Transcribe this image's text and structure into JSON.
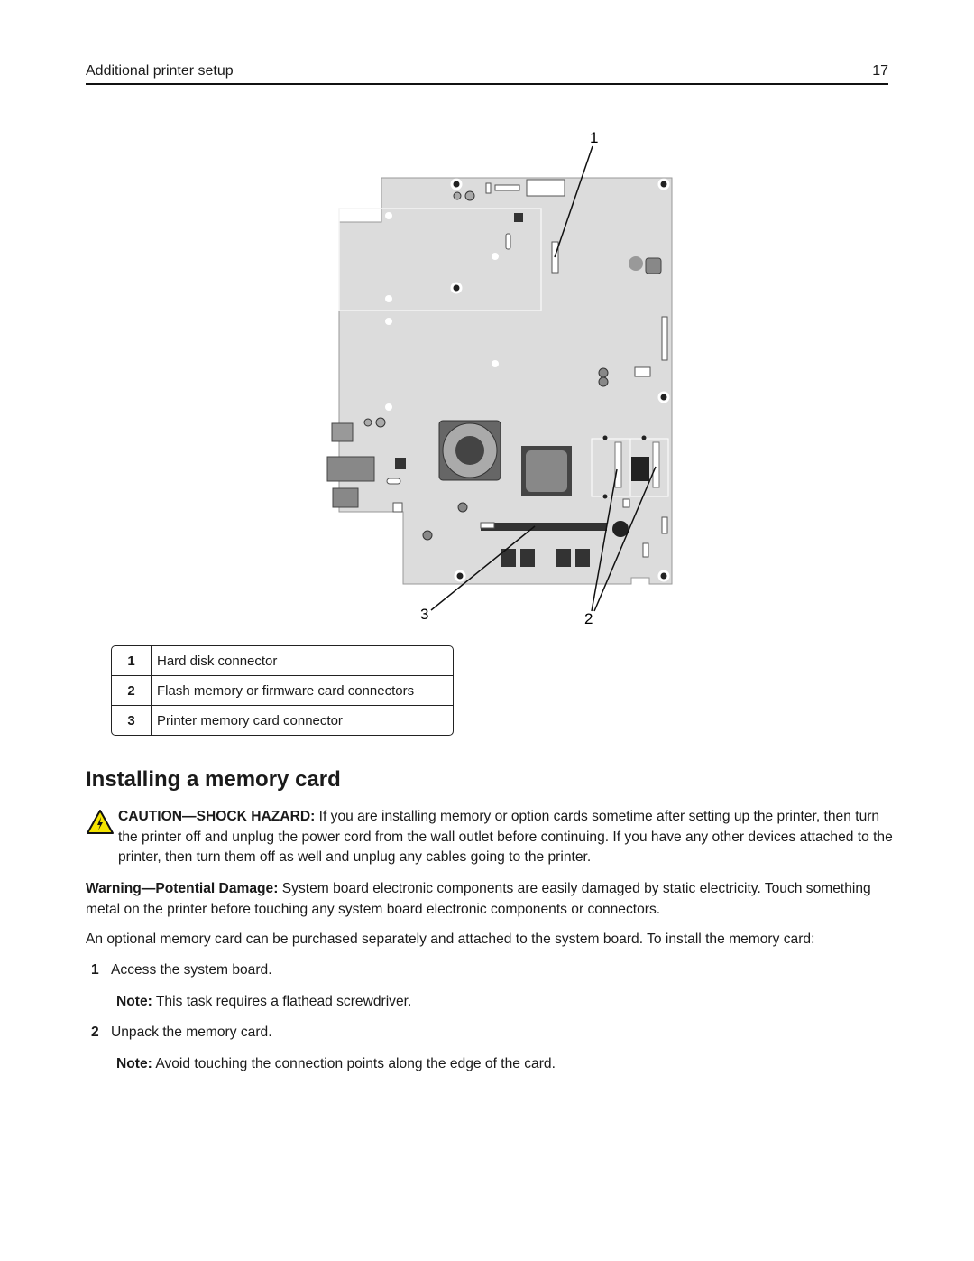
{
  "header": {
    "section_title": "Additional printer setup",
    "page_number": "17"
  },
  "figure": {
    "callouts": [
      "1",
      "2",
      "3"
    ],
    "board_color": "#dcdcdc"
  },
  "legend": [
    {
      "num": "1",
      "label": "Hard disk connector"
    },
    {
      "num": "2",
      "label": "Flash memory or firmware card connectors"
    },
    {
      "num": "3",
      "label": "Printer memory card connector"
    }
  ],
  "heading": "Installing a memory card",
  "caution": {
    "icon": "warning-shock-icon",
    "label": "CAUTION—SHOCK HAZARD:",
    "text": " If you are installing memory or option cards sometime after setting up the printer, then turn the printer off and unplug the power cord from the wall outlet before continuing. If you have any other devices attached to the printer, then turn them off as well and unplug any cables going to the printer."
  },
  "warning": {
    "label": "Warning—Potential Damage:",
    "text": " System board electronic components are easily damaged by static electricity. Touch something metal on the printer before touching any system board electronic components or connectors."
  },
  "intro": "An optional memory card can be purchased separately and attached to the system board. To install the memory card:",
  "steps": [
    {
      "num": "1",
      "text": "Access the system board.",
      "note_label": "Note:",
      "note": " This task requires a flathead screwdriver."
    },
    {
      "num": "2",
      "text": "Unpack the memory card.",
      "note_label": "Note:",
      "note": " Avoid touching the connection points along the edge of the card."
    }
  ]
}
